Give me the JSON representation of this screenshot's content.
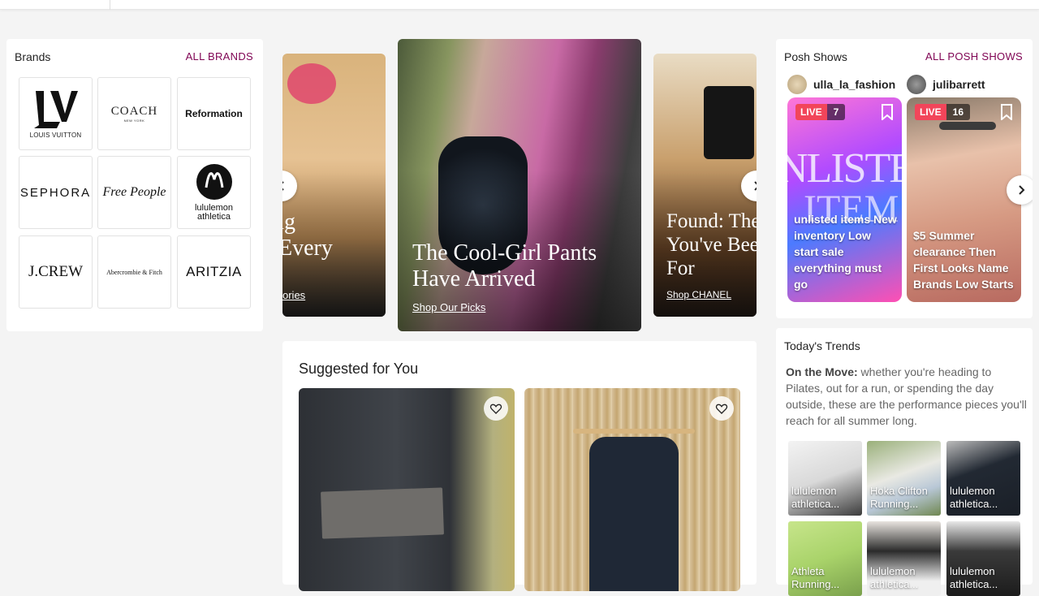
{
  "brands": {
    "title": "Brands",
    "all_label": "ALL BRANDS",
    "items": [
      {
        "name": "LOUIS VUITTON"
      },
      {
        "name": "COACH",
        "sub": "NEW YORK"
      },
      {
        "name": "Reformation"
      },
      {
        "name": "SEPHORA"
      },
      {
        "name": "Free People"
      },
      {
        "name": "lululemon athletica"
      },
      {
        "name": "J.CREW"
      },
      {
        "name": "Abercrombie & Fitch"
      },
      {
        "name": "ARITZIA"
      }
    ]
  },
  "carousel": {
    "left_title": "ng\n Every",
    "left_link": "ories",
    "center_title": "The Cool-Girl Pants Have Arrived",
    "center_link": "Shop Our Picks",
    "right_title": "Found: The You've Bee For",
    "right_link": "Shop CHANEL"
  },
  "suggested": {
    "title": "Suggested for You"
  },
  "shows": {
    "title": "Posh Shows",
    "all_label": "ALL POSH SHOWS",
    "items": [
      {
        "host": "ulla_la_fashion",
        "live": "LIVE",
        "count": "7",
        "caption": "unlisted items New inventory Low start sale everything must go",
        "big_text": "NLISTE",
        "big_text2": "ITEM"
      },
      {
        "host": "julibarrett",
        "live": "LIVE",
        "count": "16",
        "caption": "$5 Summer clearance Then First Looks Name Brands Low Starts"
      }
    ]
  },
  "trends": {
    "title": "Today's Trends",
    "lead": "On the Move:",
    "text": " whether you're heading to Pilates, out for a run, or spending the day outside, these are the performance pieces you'll reach for all summer long.",
    "tiles": [
      {
        "label": "lululemon athletica..."
      },
      {
        "label": "Hoka Clifton Running..."
      },
      {
        "label": "lululemon athletica..."
      },
      {
        "label": "Athleta Running..."
      },
      {
        "label": "lululemon athletica..."
      },
      {
        "label": "lululemon athletica..."
      }
    ]
  },
  "colors": {
    "accent": "#7f0353",
    "live": "#f2455a"
  }
}
